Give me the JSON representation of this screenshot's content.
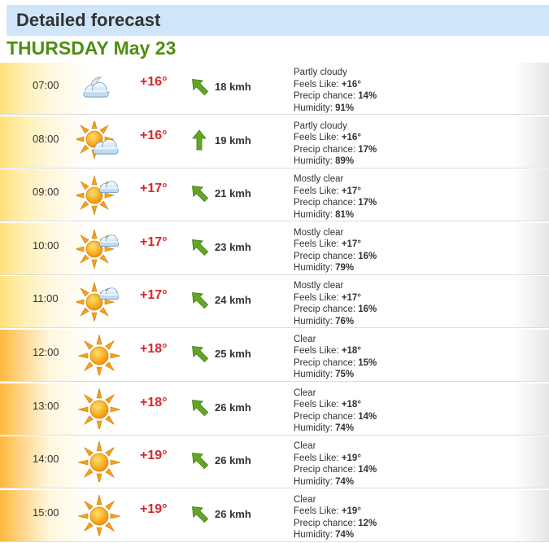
{
  "header": {
    "title": "Detailed forecast"
  },
  "day": {
    "title": "THURSDAY May 23"
  },
  "labels": {
    "feels_like": "Feels Like: ",
    "precip": "Precip chance: ",
    "humidity": "Humidity: "
  },
  "rows": [
    {
      "time": "07:00",
      "icon": "partly-cloudy-moon-icon",
      "temp": "+16°",
      "wind": "18 kmh",
      "wind_dir_deg": 315,
      "condition": "Partly cloudy",
      "feels": "+16°",
      "precip": "14%",
      "humidity": "91%"
    },
    {
      "time": "08:00",
      "icon": "partly-cloudy-sun-icon",
      "temp": "+16°",
      "wind": "19 kmh",
      "wind_dir_deg": 0,
      "condition": "Partly cloudy",
      "feels": "+16°",
      "precip": "17%",
      "humidity": "89%"
    },
    {
      "time": "09:00",
      "icon": "mostly-clear-icon",
      "temp": "+17°",
      "wind": "21 kmh",
      "wind_dir_deg": 315,
      "condition": "Mostly clear",
      "feels": "+17°",
      "precip": "17%",
      "humidity": "81%"
    },
    {
      "time": "10:00",
      "icon": "mostly-clear-icon",
      "temp": "+17°",
      "wind": "23 kmh",
      "wind_dir_deg": 315,
      "condition": "Mostly clear",
      "feels": "+17°",
      "precip": "16%",
      "humidity": "79%"
    },
    {
      "time": "11:00",
      "icon": "mostly-clear-icon",
      "temp": "+17°",
      "wind": "24 kmh",
      "wind_dir_deg": 315,
      "condition": "Mostly clear",
      "feels": "+17°",
      "precip": "16%",
      "humidity": "76%"
    },
    {
      "time": "12:00",
      "icon": "clear-sun-icon",
      "temp": "+18°",
      "wind": "25 kmh",
      "wind_dir_deg": 315,
      "condition": "Clear",
      "feels": "+18°",
      "precip": "15%",
      "humidity": "75%"
    },
    {
      "time": "13:00",
      "icon": "clear-sun-icon",
      "temp": "+18°",
      "wind": "26 kmh",
      "wind_dir_deg": 315,
      "condition": "Clear",
      "feels": "+18°",
      "precip": "14%",
      "humidity": "74%"
    },
    {
      "time": "14:00",
      "icon": "clear-sun-icon",
      "temp": "+19°",
      "wind": "26 kmh",
      "wind_dir_deg": 315,
      "condition": "Clear",
      "feels": "+19°",
      "precip": "14%",
      "humidity": "74%"
    },
    {
      "time": "15:00",
      "icon": "clear-sun-icon",
      "temp": "+19°",
      "wind": "26 kmh",
      "wind_dir_deg": 315,
      "condition": "Clear",
      "feels": "+19°",
      "precip": "12%",
      "humidity": "74%"
    }
  ],
  "colors": {
    "header_bg": "#cfe6fa",
    "day_title": "#4f8e12",
    "temp": "#d42a2a",
    "wind_arrow": "#5a9a1e"
  }
}
